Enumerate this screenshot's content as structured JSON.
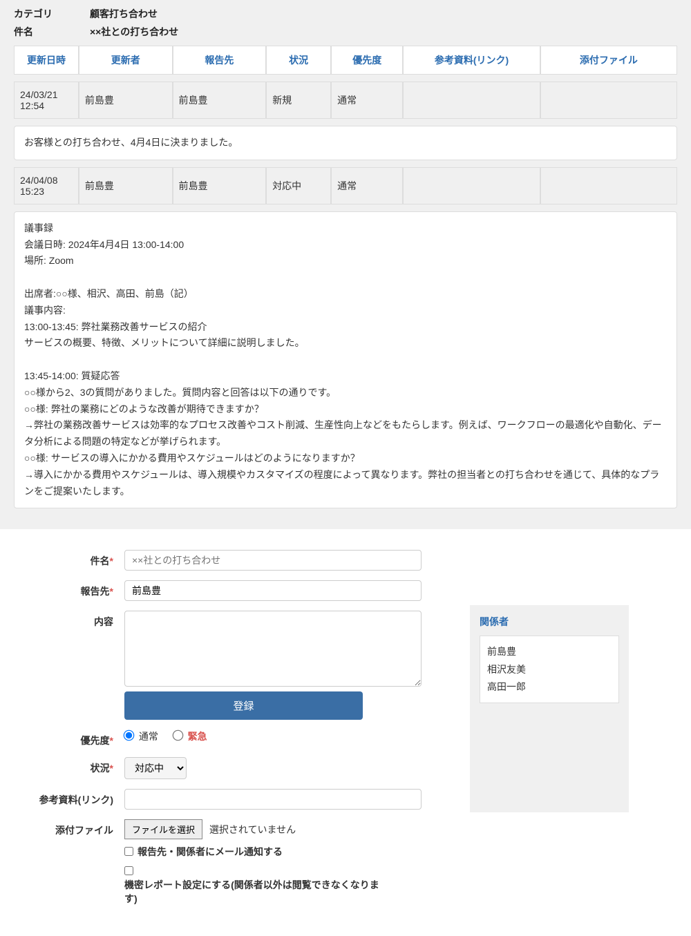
{
  "meta": {
    "category_label": "カテゴリ",
    "category_value": "顧客打ち合わせ",
    "subject_label": "件名",
    "subject_value": "××社との打ち合わせ"
  },
  "headers": {
    "updated_at": "更新日時",
    "updated_by": "更新者",
    "report_to": "報告先",
    "status": "状況",
    "priority": "優先度",
    "reference": "参考資料(リンク)",
    "attachment": "添付ファイル"
  },
  "history": [
    {
      "date": "24/03/21 12:54",
      "updater": "前島豊",
      "report_to": "前島豊",
      "status": "新規",
      "priority": "通常",
      "reference": "",
      "attachment": "",
      "note": "お客様との打ち合わせ、4月4日に決まりました。"
    },
    {
      "date": "24/04/08 15:23",
      "updater": "前島豊",
      "report_to": "前島豊",
      "status": "対応中",
      "priority": "通常",
      "reference": "",
      "attachment": "",
      "note": "議事録\n会議日時: 2024年4月4日 13:00-14:00\n場所: Zoom\n\n出席者:○○様、相沢、高田、前島（記）\n議事内容:\n13:00-13:45: 弊社業務改善サービスの紹介\nサービスの概要、特徴、メリットについて詳細に説明しました。\n\n13:45-14:00: 質疑応答\n○○様から2、3の質問がありました。質問内容と回答は以下の通りです。\n○○様: 弊社の業務にどのような改善が期待できますか？\n→弊社の業務改善サービスは効率的なプロセス改善やコスト削減、生産性向上などをもたらします。例えば、ワークフローの最適化や自動化、データ分析による問題の特定などが挙げられます。\n○○様: サービスの導入にかかる費用やスケジュールはどのようになりますか？\n→導入にかかる費用やスケジュールは、導入規模やカスタマイズの程度によって異なります。弊社の担当者との打ち合わせを通じて、具体的なプランをご提案いたします。"
    }
  ],
  "form": {
    "subject_label": "件名",
    "subject_placeholder": "××社との打ち合わせ",
    "report_to_label": "報告先",
    "report_to_value": "前島豊",
    "content_label": "内容",
    "submit_label": "登録",
    "priority_label": "優先度",
    "priority_normal": "通常",
    "priority_urgent": "緊急",
    "status_label": "状況",
    "status_value": "対応中",
    "reference_label": "参考資料(リンク)",
    "attachment_label": "添付ファイル",
    "file_button": "ファイルを選択",
    "file_status": "選択されていません",
    "notify_label": "報告先・関係者にメール通知する",
    "confidential_label": "機密レポート設定にする(関係者以外は閲覧できなくなります)"
  },
  "related": {
    "title": "関係者",
    "people": [
      "前島豊",
      "相沢友美",
      "高田一郎"
    ]
  }
}
